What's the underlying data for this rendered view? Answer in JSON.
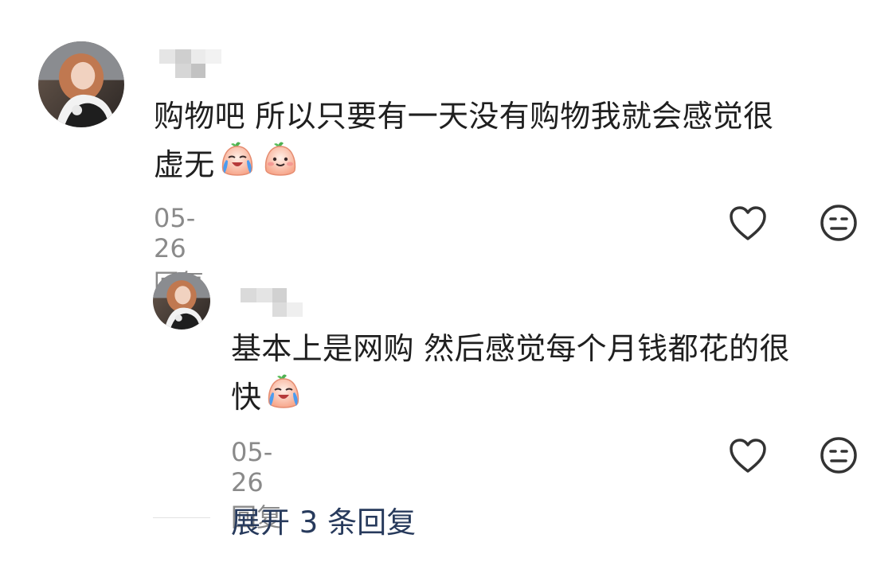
{
  "comments": [
    {
      "text_line1": "购物吧 所以只要有一天没有购物我就会感觉很",
      "text_line2": "虚无",
      "emojis": [
        "crying-peach-emoji",
        "smiling-peach-emoji"
      ],
      "date": "05-26",
      "reply_label": "回复",
      "icons": [
        "heart-icon",
        "unimpressed-face-icon"
      ]
    },
    {
      "text_line1": "基本上是网购 然后感觉每个月钱都花的很",
      "text_line2": "快",
      "emojis": [
        "crying-peach-emoji"
      ],
      "date": "05-26",
      "reply_label": "回复",
      "icons": [
        "heart-icon",
        "unimpressed-face-icon"
      ]
    }
  ],
  "expand_replies": "展开 3 条回复",
  "colors": {
    "text": "#1f1f1f",
    "meta": "#8a8a8a",
    "expand": "#273a5c",
    "icon": "#333333"
  }
}
